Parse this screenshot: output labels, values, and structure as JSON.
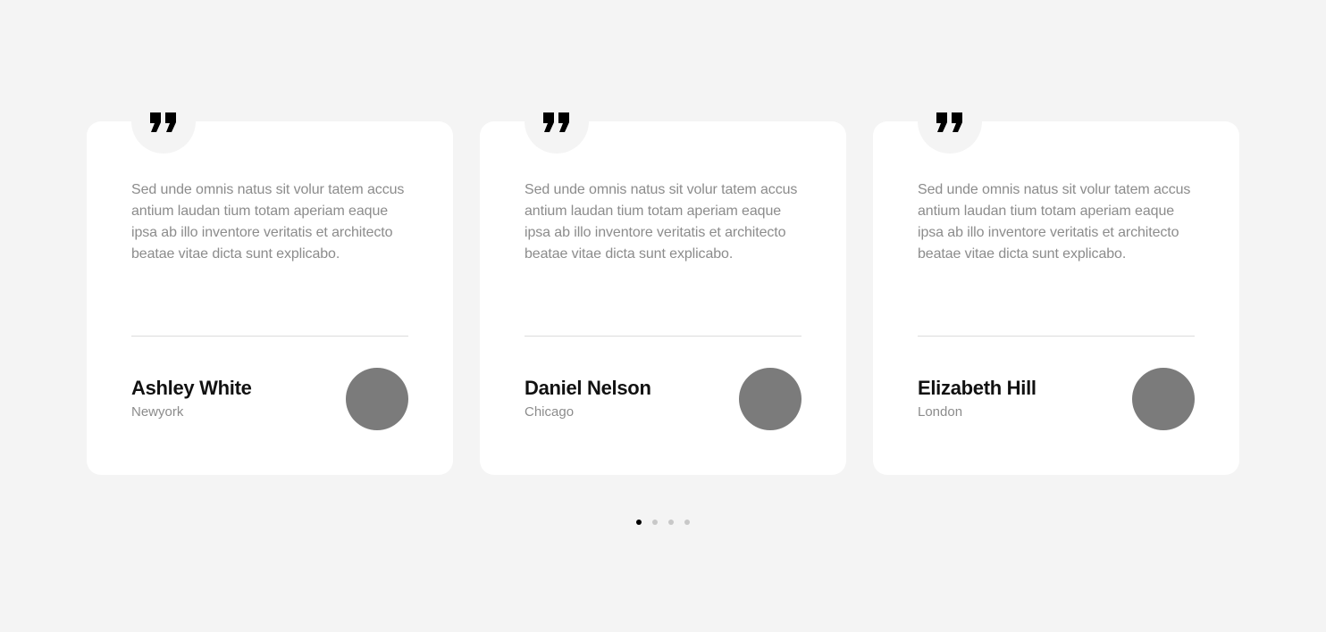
{
  "colors": {
    "background": "#f4f4f4",
    "card": "#ffffff",
    "quote_icon": "#000000",
    "body_text": "#8c8c8c",
    "name_text": "#111111",
    "avatar_placeholder": "#7b7b7b",
    "dot_active": "#000000",
    "dot_inactive": "#c8c8c8"
  },
  "testimonials": [
    {
      "icon": "quote-icon",
      "text": "Sed unde omnis natus sit volur tatem accus antium laudan tium totam aperiam eaque ipsa ab illo inventore veritatis et architecto beatae vitae dicta sunt explicabo.",
      "name": "Ashley White",
      "city": "Newyork"
    },
    {
      "icon": "quote-icon",
      "text": "Sed unde omnis natus sit volur tatem accus antium laudan tium totam aperiam eaque ipsa ab illo inventore veritatis et architecto beatae vitae dicta sunt explicabo.",
      "name": "Daniel Nelson",
      "city": "Chicago"
    },
    {
      "icon": "quote-icon",
      "text": "Sed unde omnis natus sit volur tatem accus antium laudan tium totam aperiam eaque ipsa ab illo inventore veritatis et architecto beatae vitae dicta sunt explicabo.",
      "name": "Elizabeth Hill",
      "city": "London"
    }
  ],
  "pagination": {
    "total": 4,
    "active": 1
  }
}
